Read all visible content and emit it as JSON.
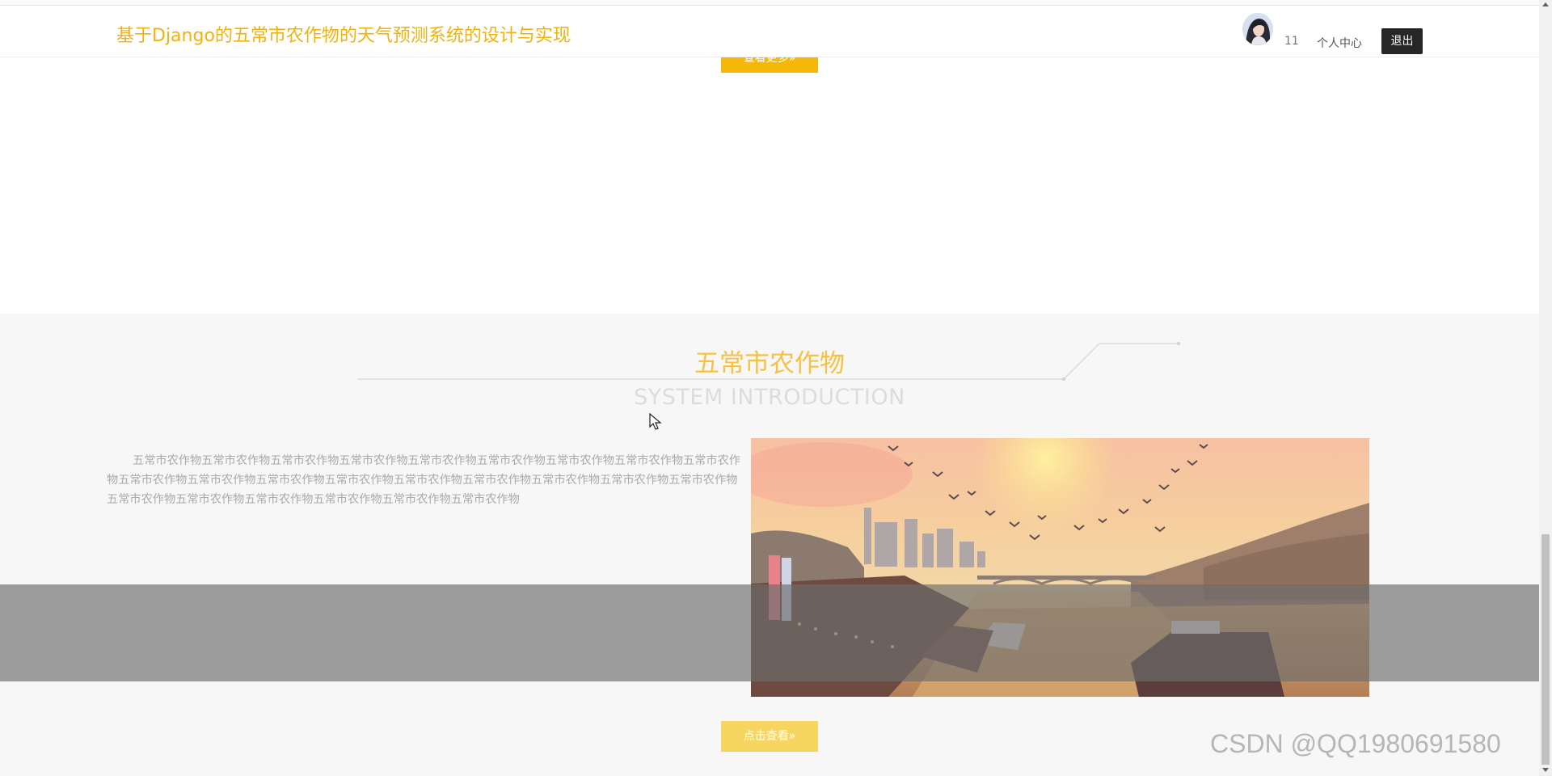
{
  "header": {
    "title": "基于Django的五常市农作物的天气预测系统的设计与实现",
    "username": "11",
    "profile_label": "个人中心",
    "logout_label": "退出",
    "title_color": "#f2b20c"
  },
  "view_more_label": "查看更多»",
  "section": {
    "title": "五常市农作物",
    "subtitle": "SYSTEM INTRODUCTION",
    "intro_text": "五常市农作物五常市农作物五常市农作物五常市农作物五常市农作物五常市农作物五常市农作物五常市农作物五常市农作物五常市农作物五常市农作物五常市农作物五常市农作物五常市农作物五常市农作物五常市农作物五常市农作物五常市农作物五常市农作物五常市农作物五常市农作物五常市农作物五常市农作物五常市农作物",
    "click_view_label": "点击查看»",
    "accent_color": "#f5b70a"
  },
  "watermark": "CSDN @QQ1980691580"
}
